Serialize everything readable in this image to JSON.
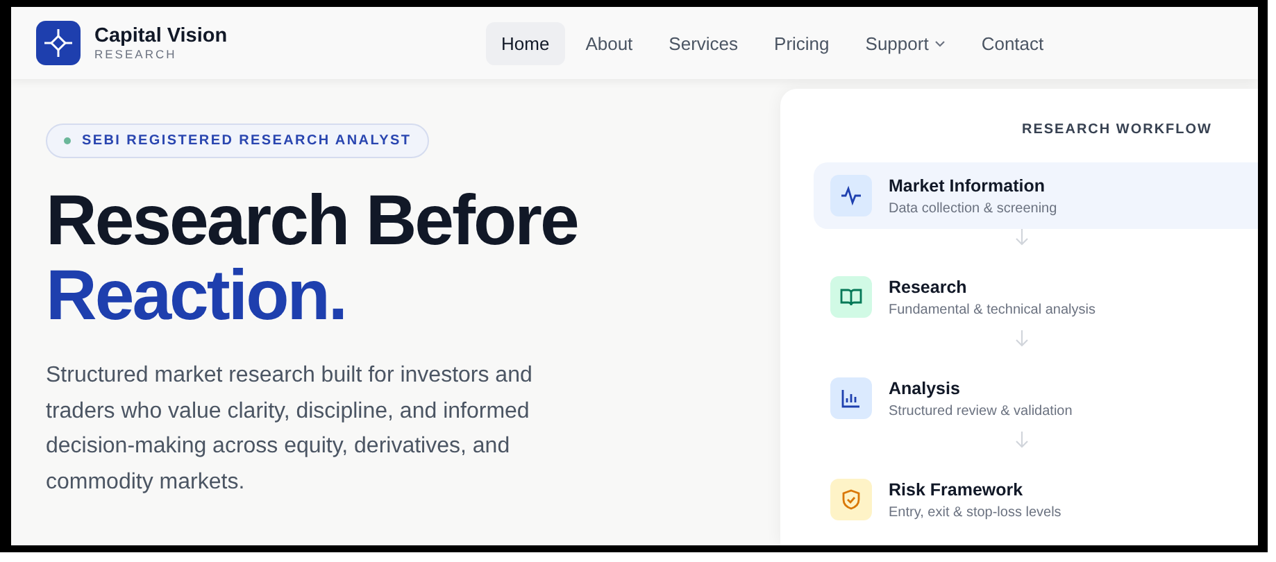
{
  "brand": {
    "name": "Capital Vision",
    "tagline": "RESEARCH"
  },
  "nav": [
    {
      "label": "Home",
      "selected": true,
      "has_menu": false
    },
    {
      "label": "About",
      "selected": false,
      "has_menu": false
    },
    {
      "label": "Services",
      "selected": false,
      "has_menu": false
    },
    {
      "label": "Pricing",
      "selected": false,
      "has_menu": false
    },
    {
      "label": "Support",
      "selected": false,
      "has_menu": true
    },
    {
      "label": "Contact",
      "selected": false,
      "has_menu": false
    }
  ],
  "hero": {
    "badge": "SEBI REGISTERED RESEARCH ANALYST",
    "title_line1": "Research Before",
    "title_line2": "Reaction.",
    "description": "Structured market research built for investors and traders who value clarity, discipline, and informed decision-making across equity, derivatives, and commodity markets."
  },
  "workflow": {
    "title": "RESEARCH WORKFLOW",
    "steps": [
      {
        "kind": "pulse",
        "title": "Market Information",
        "subtitle": "Data collection & screening",
        "color": "#dbeafe",
        "selected": true
      },
      {
        "kind": "book",
        "title": "Research",
        "subtitle": "Fundamental & technical analysis",
        "color": "#d1fae5",
        "selected": false
      },
      {
        "kind": "bars",
        "title": "Analysis",
        "subtitle": "Structured review & validation",
        "color": "#dbeafe",
        "selected": false
      },
      {
        "kind": "shield",
        "title": "Risk Framework",
        "subtitle": "Entry, exit & stop-loss levels",
        "color": "#fef3c7",
        "selected": false
      }
    ]
  }
}
